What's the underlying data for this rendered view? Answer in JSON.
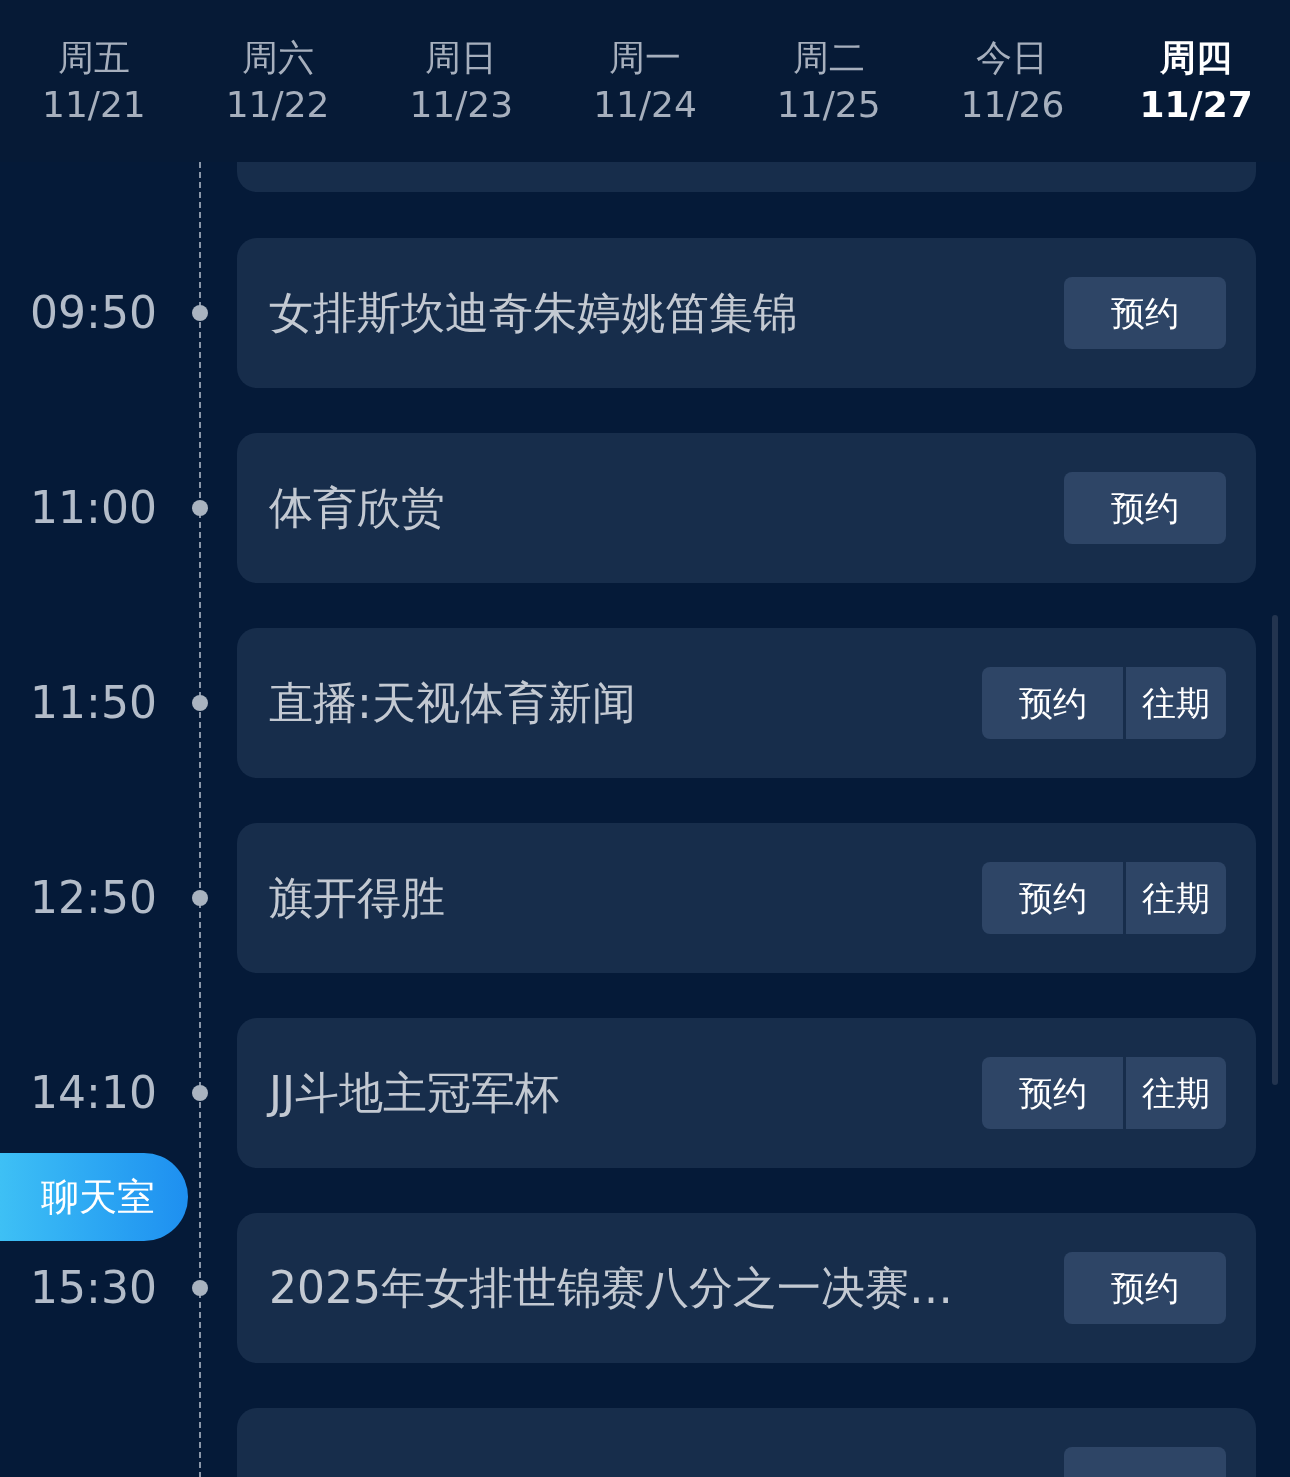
{
  "days": [
    {
      "weekday": "周五",
      "date": "11/21",
      "selected": false
    },
    {
      "weekday": "周六",
      "date": "11/22",
      "selected": false
    },
    {
      "weekday": "周日",
      "date": "11/23",
      "selected": false
    },
    {
      "weekday": "周一",
      "date": "11/24",
      "selected": false
    },
    {
      "weekday": "周二",
      "date": "11/25",
      "selected": false
    },
    {
      "weekday": "今日",
      "date": "11/26",
      "selected": false
    },
    {
      "weekday": "周四",
      "date": "11/27",
      "selected": true
    }
  ],
  "programs": [
    {
      "time": "09:50",
      "title": "女排斯坎迪奇朱婷姚笛集锦",
      "buttons": [
        "预约"
      ]
    },
    {
      "time": "11:00",
      "title": "体育欣赏",
      "buttons": [
        "预约"
      ]
    },
    {
      "time": "11:50",
      "title": "直播:天视体育新闻",
      "buttons": [
        "预约",
        "往期"
      ]
    },
    {
      "time": "12:50",
      "title": "旗开得胜",
      "buttons": [
        "预约",
        "往期"
      ]
    },
    {
      "time": "14:10",
      "title": "JJ斗地主冠军杯",
      "buttons": [
        "预约",
        "往期"
      ]
    },
    {
      "time": "15:30",
      "title": "2025年女排世锦赛八分之一决赛…",
      "buttons": [
        "预约"
      ]
    }
  ],
  "chat_button": "聊天室"
}
